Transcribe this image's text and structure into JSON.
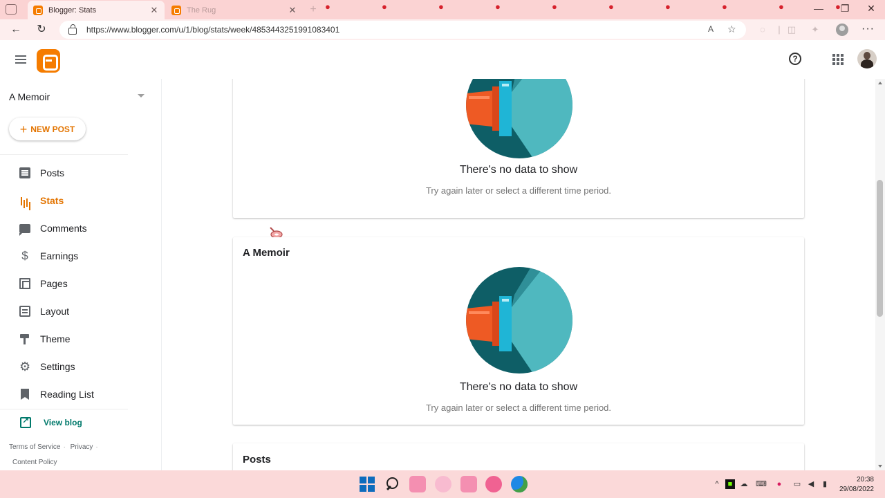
{
  "browser": {
    "tabs": [
      {
        "title": "Blogger: Stats",
        "active": true
      },
      {
        "title": "The Rug",
        "active": false
      }
    ],
    "url": "https://www.blogger.com/u/1/blog/stats/week/4853443251991083401",
    "read_aloud_label": "A",
    "window_controls": {
      "minimize": "—",
      "restore": "❐",
      "close": "✕"
    }
  },
  "header": {
    "help_glyph": "?"
  },
  "sidebar": {
    "blog_name": "A Memoir",
    "new_post_label": "NEW POST",
    "items": [
      {
        "label": "Posts",
        "icon": "posts-icon",
        "active": false
      },
      {
        "label": "Stats",
        "icon": "stats-icon",
        "active": true
      },
      {
        "label": "Comments",
        "icon": "comments-icon",
        "active": false
      },
      {
        "label": "Earnings",
        "icon": "earnings-icon",
        "active": false
      },
      {
        "label": "Pages",
        "icon": "pages-icon",
        "active": false
      },
      {
        "label": "Layout",
        "icon": "layout-icon",
        "active": false
      },
      {
        "label": "Theme",
        "icon": "theme-icon",
        "active": false
      },
      {
        "label": "Settings",
        "icon": "settings-icon",
        "active": false
      },
      {
        "label": "Reading List",
        "icon": "reading-list-icon",
        "active": false
      }
    ],
    "view_blog_label": "View blog",
    "footer": {
      "terms": "Terms of Service",
      "privacy": "Privacy",
      "content_policy": "Content Policy"
    }
  },
  "main": {
    "cards": [
      {
        "title": "",
        "empty_title": "There's no data to show",
        "empty_sub": "Try again later or select a different time period."
      },
      {
        "title": "A Memoir",
        "empty_title": "There's no data to show",
        "empty_sub": "Try again later or select a different time period."
      },
      {
        "title": "Posts"
      }
    ]
  },
  "taskbar": {
    "time": "20:38",
    "date": "29/08/2022"
  },
  "colors": {
    "accent": "#e37400",
    "teal": "#00796b",
    "chrome_pink": "#fbd3d3"
  }
}
